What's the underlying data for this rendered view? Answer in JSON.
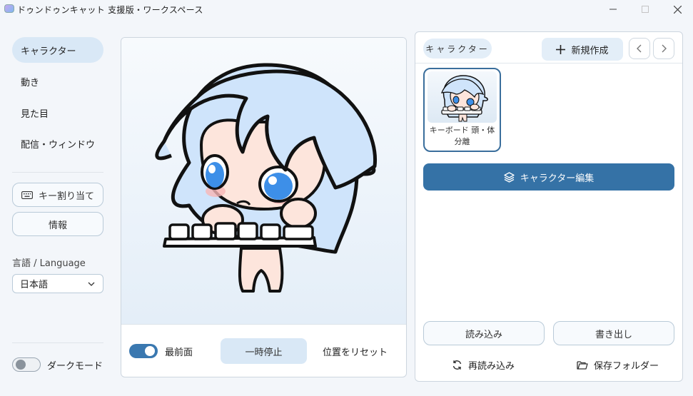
{
  "window": {
    "title": "ドゥンドゥンキャット 支援版・ワークスペース"
  },
  "sidebar": {
    "items": [
      {
        "label": "キャラクター",
        "active": true
      },
      {
        "label": "動き",
        "active": false
      },
      {
        "label": "見た目",
        "active": false
      },
      {
        "label": "配信・ウィンドウ",
        "active": false
      }
    ],
    "key_assign_label": "キー割り当て",
    "info_label": "情報",
    "language_label": "言語 / Language",
    "language_value": "日本語",
    "dark_mode_label": "ダークモード",
    "dark_mode_on": false
  },
  "preview": {
    "always_on_top_label": "最前面",
    "always_on_top_on": true,
    "pause_label": "一時停止",
    "reset_position_label": "位置をリセット"
  },
  "character_panel": {
    "section_chip": "キャラクター",
    "new_label": "新規作成",
    "cards": [
      {
        "name": "キーボード 頭・体分離",
        "selected": true
      }
    ],
    "edit_label": "キャラクター編集",
    "import_label": "読み込み",
    "export_label": "書き出し",
    "reload_label": "再読み込み",
    "save_folder_label": "保存フォルダー"
  },
  "colors": {
    "accent": "#3572a6",
    "accent_light": "#d9e8f6",
    "background": "#f3f6fa",
    "hair": "#cfe4fb",
    "eyes": "#3d8fe8"
  }
}
